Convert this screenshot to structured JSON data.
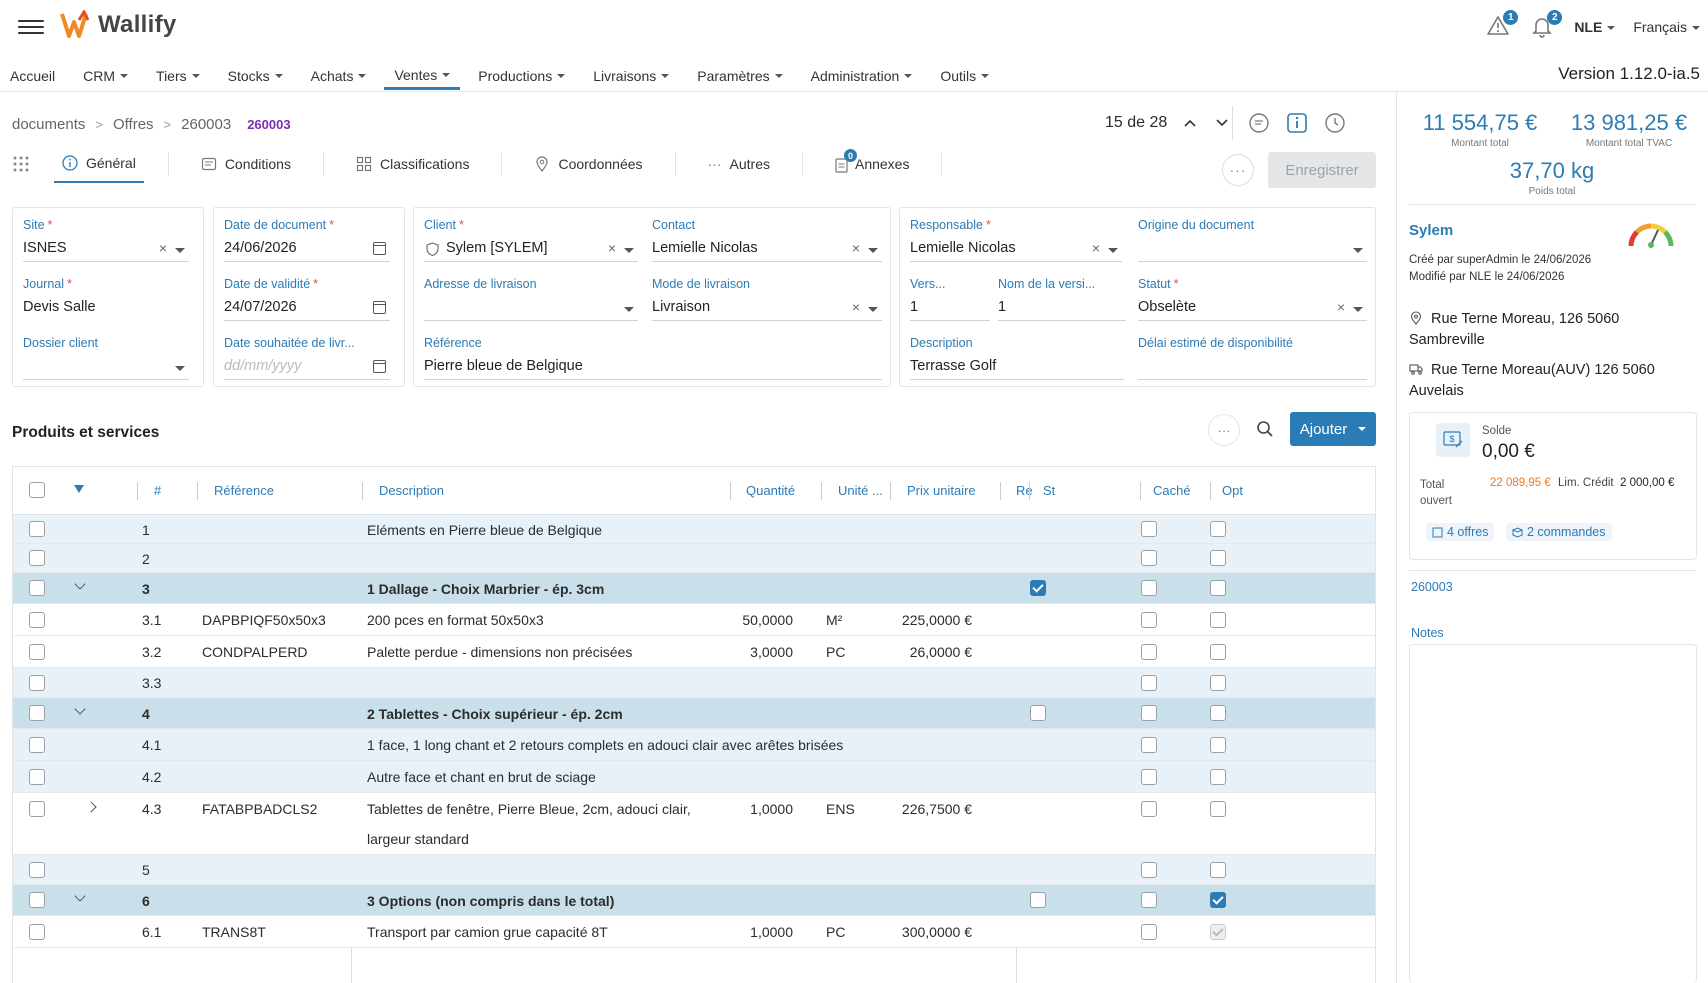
{
  "app": {
    "brand": "Wallify",
    "version": "Version 1.12.0-ia.5",
    "user": "NLE",
    "language": "Français",
    "alerts_count": "1",
    "notifications_count": "2",
    "accent_color": "#2b7bb5"
  },
  "nav": [
    "Accueil",
    "CRM",
    "Tiers",
    "Stocks",
    "Achats",
    "Ventes",
    "Productions",
    "Livraisons",
    "Paramètres",
    "Administration",
    "Outils"
  ],
  "breadcrumb": {
    "root": "documents",
    "section": "Offres",
    "doc": "260003",
    "tag": "260003"
  },
  "pager": {
    "text": "15 de 28"
  },
  "tabs": {
    "general": "Général",
    "conditions": "Conditions",
    "classifications": "Classifications",
    "coordonnees": "Coordonnées",
    "autres": "Autres",
    "annexes": "Annexes",
    "annexes_count": "0"
  },
  "save_label": "Enregistrer",
  "form": {
    "site": {
      "label": "Site",
      "value": "ISNES"
    },
    "journal": {
      "label": "Journal",
      "value": "Devis Salle"
    },
    "dossier": {
      "label": "Dossier client",
      "value": ""
    },
    "date_doc": {
      "label": "Date de document",
      "value": "24/06/2026"
    },
    "date_valid": {
      "label": "Date de validité",
      "value": "24/07/2026"
    },
    "date_souh": {
      "label": "Date souhaitée de livr...",
      "placeholder": "dd/mm/yyyy"
    },
    "client": {
      "label": "Client",
      "value": "Sylem [SYLEM]"
    },
    "contact": {
      "label": "Contact",
      "value": "Lemielle Nicolas"
    },
    "adresse": {
      "label": "Adresse de livraison",
      "value": ""
    },
    "mode": {
      "label": "Mode de livraison",
      "value": "Livraison"
    },
    "reference": {
      "label": "Référence",
      "value": "Pierre bleue de Belgique"
    },
    "responsable": {
      "label": "Responsable",
      "value": "Lemielle Nicolas"
    },
    "origine": {
      "label": "Origine du document",
      "value": ""
    },
    "version": {
      "label": "Vers...",
      "value": "1"
    },
    "nom_version": {
      "label": "Nom de la versi...",
      "value": "1"
    },
    "statut": {
      "label": "Statut",
      "value": "Obselète"
    },
    "description": {
      "label": "Description",
      "value": "Terrasse Golf"
    },
    "delai": {
      "label": "Délai estimé de disponibilité",
      "value": ""
    }
  },
  "products": {
    "title": "Produits et services",
    "add_label": "Ajouter",
    "columns": {
      "num": "#",
      "ref": "Référence",
      "desc": "Description",
      "qty": "Quantité",
      "unit": "Unité ...",
      "price": "Prix unitaire",
      "re": "Re",
      "st": "St",
      "cache": "Caché",
      "opt": "Opt"
    },
    "rows": [
      {
        "num": "1",
        "ref": "",
        "desc": "Eléments en Pierre bleue de Belgique",
        "qty": "",
        "unit": "",
        "price": ""
      },
      {
        "num": "2",
        "ref": "",
        "desc": "",
        "qty": "",
        "unit": "",
        "price": ""
      },
      {
        "num": "3",
        "ref": "",
        "desc": "1 Dallage - Choix Marbrier - ép. 3cm",
        "qty": "",
        "unit": "",
        "price": ""
      },
      {
        "num": "3.1",
        "ref": "DAPBPIQF50x50x3",
        "desc": "200 pces en format 50x50x3",
        "qty": "50,0000",
        "unit": "M²",
        "price": "225,0000 €"
      },
      {
        "num": "3.2",
        "ref": "CONDPALPERD",
        "desc": "Palette perdue - dimensions non précisées",
        "qty": "3,0000",
        "unit": "PC",
        "price": "26,0000 €"
      },
      {
        "num": "3.3",
        "ref": "",
        "desc": "",
        "qty": "",
        "unit": "",
        "price": ""
      },
      {
        "num": "4",
        "ref": "",
        "desc": "2 Tablettes - Choix supérieur - ép. 2cm",
        "qty": "",
        "unit": "",
        "price": ""
      },
      {
        "num": "4.1",
        "ref": "",
        "desc": "1 face, 1 long chant et 2 retours complets en adouci clair avec arêtes brisées",
        "qty": "",
        "unit": "",
        "price": ""
      },
      {
        "num": "4.2",
        "ref": "",
        "desc": "Autre face et chant en brut de sciage",
        "qty": "",
        "unit": "",
        "price": ""
      },
      {
        "num": "4.3",
        "ref": "FATABPBADCLS2",
        "desc": "Tablettes de fenêtre, Pierre Bleue, 2cm, adouci clair,",
        "desc2": "largeur standard",
        "qty": "1,0000",
        "unit": "ENS",
        "price": "226,7500 €"
      },
      {
        "num": "5",
        "ref": "",
        "desc": "",
        "qty": "",
        "unit": "",
        "price": ""
      },
      {
        "num": "6",
        "ref": "",
        "desc": "3 Options (non compris dans le total)",
        "qty": "",
        "unit": "",
        "price": ""
      },
      {
        "num": "6.1",
        "ref": "TRANS8T",
        "desc": "Transport par camion grue capacité 8T",
        "qty": "1,0000",
        "unit": "PC",
        "price": "300,0000 €"
      }
    ]
  },
  "summary": {
    "total": "11 554,75 €",
    "total_label": "Montant total",
    "total_tvac": "13 981,25 €",
    "total_tvac_label": "Montant total TVAC",
    "weight": "37,70 kg",
    "weight_label": "Poids total"
  },
  "customer": {
    "name": "Sylem",
    "created": "Créé par superAdmin le 24/06/2026",
    "modified": "Modifié par NLE le 24/06/2026",
    "addr1_l1": "Rue Terne Moreau, 126 5060",
    "addr1_l2": "Sambreville",
    "addr2_l1": "Rue Terne Moreau(AUV) 126 5060",
    "addr2_l2": "Auvelais",
    "solde_label": "Solde",
    "solde": "0,00 €",
    "total_ouvert_label": "Total ouvert",
    "total_ouvert": "22 089,95 €",
    "credit_label": "Lim. Crédit",
    "credit": "2 000,00 €",
    "offers": "4 offres",
    "orders": "2 commandes"
  },
  "related_doc": "260003",
  "notes_label": "Notes"
}
